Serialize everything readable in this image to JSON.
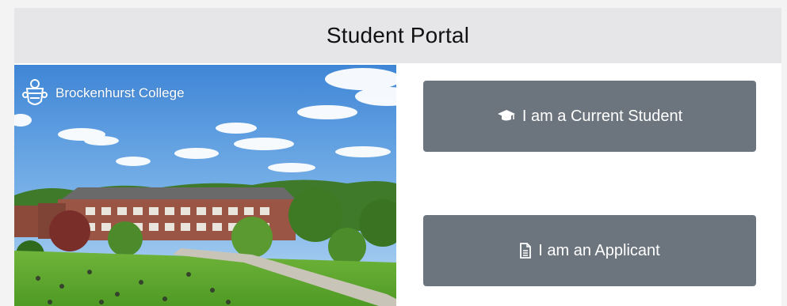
{
  "header": {
    "title": "Student Portal"
  },
  "hero": {
    "college_name": "Brockenhurst College",
    "crest_icon": "college-crest-icon"
  },
  "buttons": {
    "current_student": {
      "label": "I am a Current Student",
      "icon": "graduation-cap-icon"
    },
    "applicant": {
      "label": "I am an Applicant",
      "icon": "file-text-icon"
    }
  },
  "colors": {
    "header_bg": "#e6e6e8",
    "button_bg": "#6c757d",
    "button_text": "#ffffff"
  }
}
